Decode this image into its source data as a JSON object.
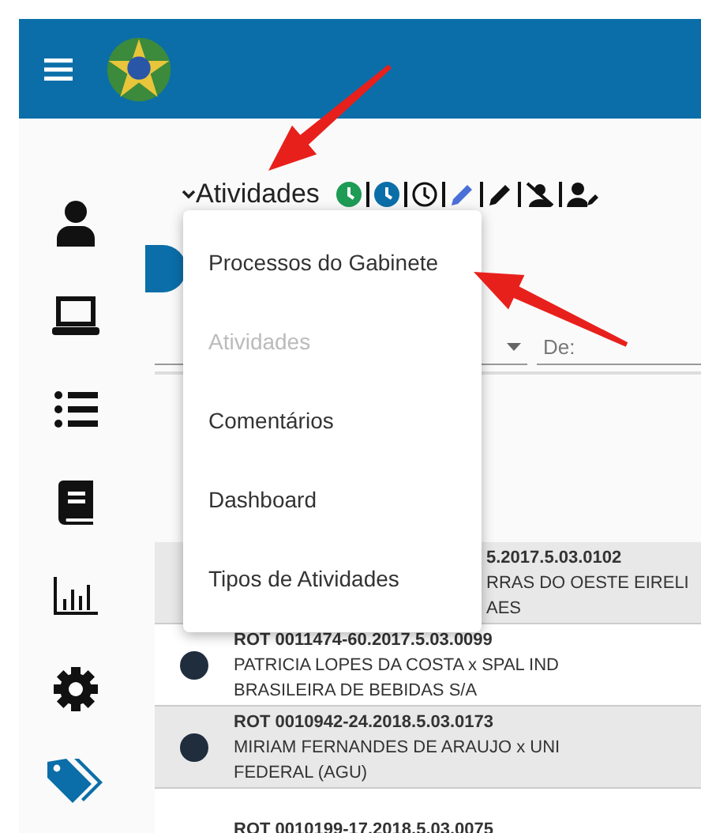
{
  "sidebar": {
    "items": [
      {
        "kind": "user",
        "selected": false
      },
      {
        "kind": "laptop",
        "selected": false
      },
      {
        "kind": "list",
        "selected": false
      },
      {
        "kind": "book",
        "selected": false
      },
      {
        "kind": "chart",
        "selected": false
      },
      {
        "kind": "gear",
        "selected": false
      },
      {
        "kind": "tags",
        "selected": true
      }
    ]
  },
  "toolbar": {
    "title": "Atividades",
    "icons": [
      {
        "kind": "clock-solid",
        "color": "#1e9b55"
      },
      {
        "kind": "clock-solid",
        "color": "#0b6ea8"
      },
      {
        "kind": "clock-outline",
        "color": "#111111"
      },
      {
        "kind": "pencil",
        "color": "#4a6fd8"
      },
      {
        "kind": "pencil",
        "color": "#111111"
      },
      {
        "kind": "user-slash",
        "color": "#111111"
      },
      {
        "kind": "user-edit",
        "color": "#111111"
      }
    ]
  },
  "menu": {
    "items": [
      {
        "label": "Processos do Gabinete",
        "disabled": false
      },
      {
        "label": "Atividades",
        "disabled": true
      },
      {
        "label": "Comentários",
        "disabled": false
      },
      {
        "label": "Dashboard",
        "disabled": false
      },
      {
        "label": "Tipos de Atividades",
        "disabled": false
      }
    ]
  },
  "filter": {
    "date_placeholder": "De:"
  },
  "table": {
    "rows": [
      {
        "covered": true,
        "number": "5.2017.5.03.0102",
        "parties": [
          "RRAS DO OESTE EIRELI",
          "AES"
        ]
      },
      {
        "avatar": true,
        "covered": false,
        "number": "ROT 0011474-60.2017.5.03.0099",
        "parties": [
          "PATRICIA LOPES DA COSTA x SPAL IND",
          "BRASILEIRA DE BEBIDAS S/A"
        ]
      },
      {
        "avatar": true,
        "covered": false,
        "number": "ROT 0010942-24.2018.5.03.0173",
        "parties": [
          "MIRIAM FERNANDES DE ARAUJO x UNI",
          "FEDERAL (AGU)"
        ]
      },
      {
        "avatar": false,
        "covered": false,
        "number": "ROT 0010199-17.2018.5.03.0075",
        "parties": []
      }
    ]
  }
}
